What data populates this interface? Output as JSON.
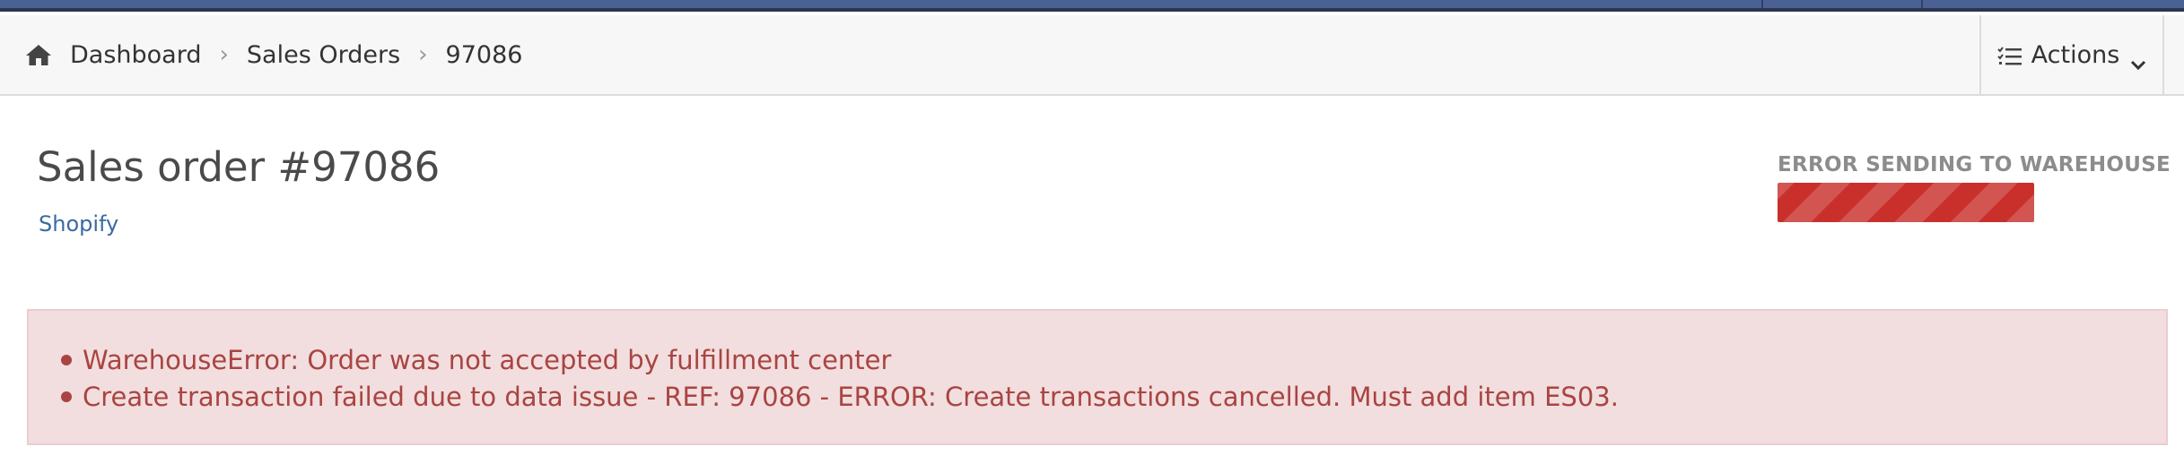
{
  "breadcrumb": {
    "items": [
      "Dashboard",
      "Sales Orders"
    ],
    "current": "97086"
  },
  "actions": {
    "label": "Actions"
  },
  "order": {
    "title": "Sales order #97086",
    "source": "Shopify"
  },
  "status": {
    "label": "ERROR SENDING TO WAREHOUSE",
    "color": "#c9302c",
    "progress": 1.0
  },
  "errors": [
    "WarehouseError: Order was not accepted by fulfillment center",
    "Create transaction failed due to data issue - REF: 97086 - ERROR: Create transactions cancelled. Must add item ES03."
  ],
  "colors": {
    "navbar": "#4a6293",
    "alert_bg": "#f2dede",
    "alert_text": "#a94442",
    "link": "#3a6aa0"
  },
  "icons": {
    "home": "home-icon",
    "actions": "list-icon",
    "actions_caret": "chevron-down-icon",
    "breadcrumb_separator": "chevron-right-icon"
  }
}
